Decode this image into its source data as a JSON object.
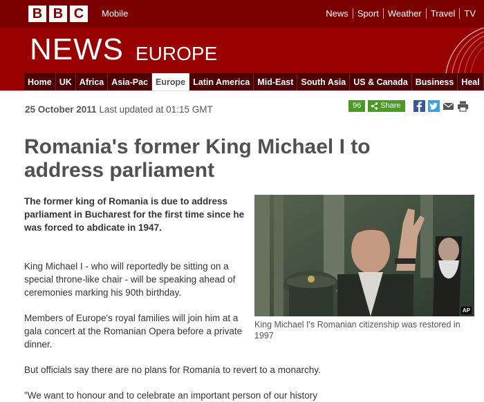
{
  "masthead": {
    "logo_letters": [
      "B",
      "B",
      "C"
    ],
    "mobile_label": "Mobile",
    "top_nav": [
      "News",
      "Sport",
      "Weather",
      "Travel",
      "TV"
    ]
  },
  "banner": {
    "news_label": "NEWS",
    "section_label": "EUROPE"
  },
  "section_nav": {
    "items": [
      "Home",
      "UK",
      "Africa",
      "Asia-Pac",
      "Europe",
      "Latin America",
      "Mid-East",
      "South Asia",
      "US & Canada",
      "Business",
      "Heal"
    ],
    "active": "Europe"
  },
  "article": {
    "date": "25 October 2011",
    "last_updated": "Last updated at 01:15 GMT",
    "share_count": "96",
    "share_label": "Share",
    "headline": "Romania's former King Michael I to address parliament",
    "intro": "The former king of Romania is due to address parliament in Bucharest for the first time since he was forced to abdicate in 1947.",
    "para1": "King Michael I - who will reportedly be sitting on a special throne-like chair - will be speaking ahead of ceremonies marking his 90th birthday.",
    "para2": "Members of Europe's royal families will join him at a gala concert at the Romanian Opera before a private dinner.",
    "para3": "But officials say there are no plans for Romania to revert to a monarchy.",
    "para4": "\"We want to honour and to celebrate an important person of our history",
    "photo_credit": "AP",
    "caption": "King Michael I's Romanian citizenship was restored in 1997"
  },
  "colors": {
    "masthead_dark": "#7d0000",
    "banner_red": "#990000",
    "nav_dark": "#4d0000",
    "share_green": "#4a9a24"
  },
  "icons": [
    "facebook-icon",
    "twitter-icon",
    "email-icon",
    "print-icon",
    "share-icon"
  ]
}
